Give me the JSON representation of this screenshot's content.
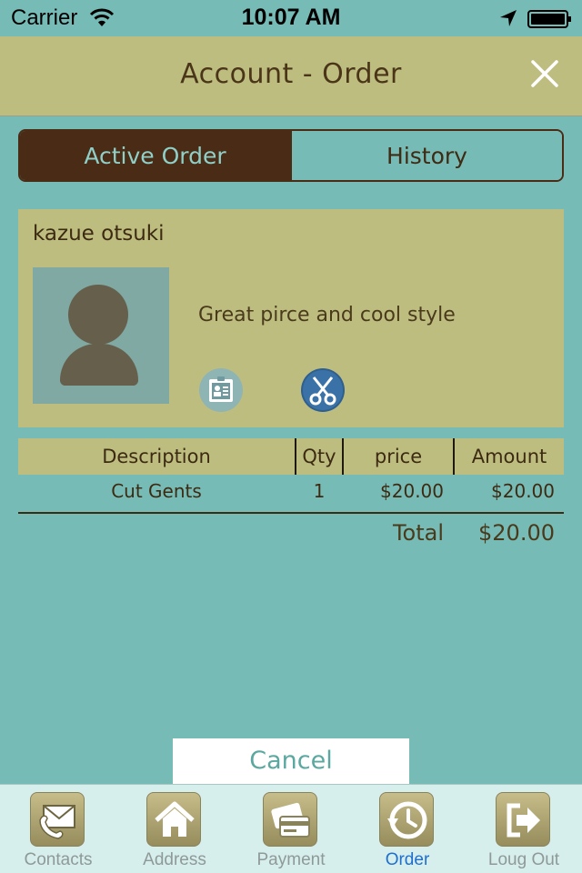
{
  "status_bar": {
    "carrier": "Carrier",
    "time": "10:07 AM"
  },
  "nav": {
    "title": "Account - Order",
    "close_icon": "close-icon"
  },
  "segments": {
    "active_order": "Active Order",
    "history": "History",
    "selected": "Active Order"
  },
  "customer": {
    "name": "kazue otsuki",
    "comment": "Great pirce and cool style",
    "icons": [
      "contact-card-icon",
      "scissors-icon"
    ]
  },
  "order_table": {
    "headers": {
      "description": "Description",
      "qty": "Qty",
      "price": "price",
      "amount": "Amount"
    },
    "rows": [
      {
        "description": "Cut Gents",
        "qty": "1",
        "price": "$20.00",
        "amount": "$20.00"
      }
    ],
    "total_label": "Total",
    "total_value": "$20.00"
  },
  "cancel_label": "Cancel",
  "tabs": [
    {
      "label": "Contacts",
      "icon": "contacts-phone-mail-icon"
    },
    {
      "label": "Address",
      "icon": "house-icon"
    },
    {
      "label": "Payment",
      "icon": "credit-card-icon"
    },
    {
      "label": "Order",
      "icon": "clock-history-icon"
    },
    {
      "label": "Loug Out",
      "icon": "logout-arrow-icon"
    }
  ],
  "active_tab": "Order",
  "colors": {
    "background": "#77bbb6",
    "bar": "#bebd80",
    "segment_active": "#4a2c16",
    "tab_active": "#1f6fd1",
    "tab_inactive": "#8f9a98"
  }
}
